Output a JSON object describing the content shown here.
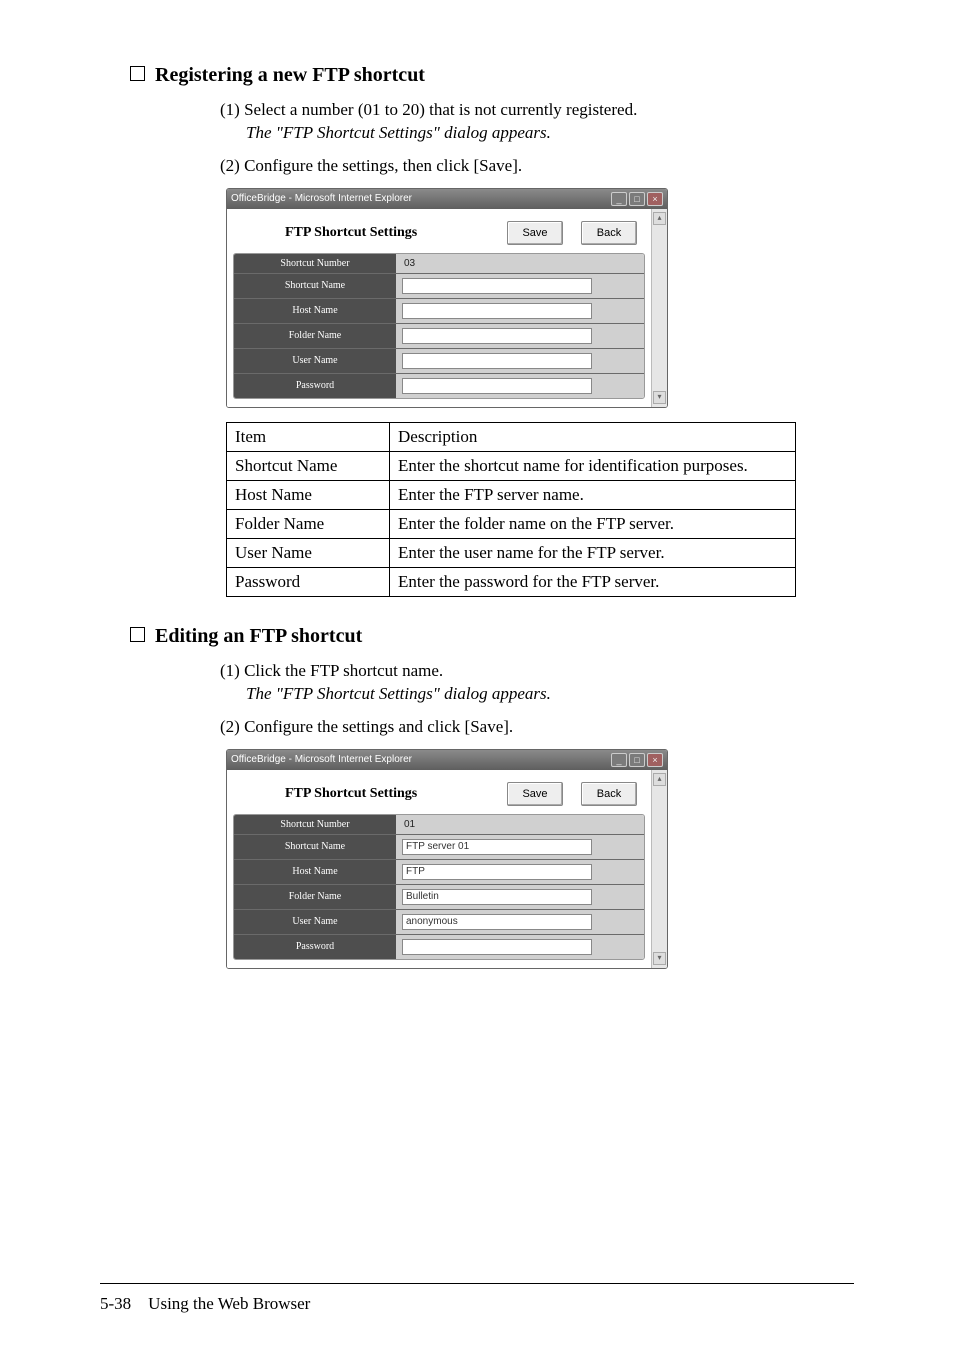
{
  "section1": {
    "title": "Registering a new FTP shortcut",
    "step1": "(1) Select a number (01 to 20) that is not currently registered.",
    "step1_note": "The \"FTP Shortcut Settings\" dialog appears.",
    "step2": "(2) Configure the settings, then click [Save]."
  },
  "section2": {
    "title": "Editing an FTP shortcut",
    "step1": "(1) Click the FTP shortcut name.",
    "step1_note": "The \"FTP Shortcut Settings\" dialog appears.",
    "step2": "(2) Configure the settings and click [Save]."
  },
  "ie_title": "OfficeBridge - Microsoft Internet Explorer",
  "dialog": {
    "title": "FTP Shortcut Settings",
    "save": "Save",
    "back": "Back",
    "labels": {
      "number": "Shortcut Number",
      "name": "Shortcut Name",
      "host": "Host Name",
      "folder": "Folder Name",
      "user": "User Name",
      "pass": "Password"
    }
  },
  "dlg1": {
    "number": "03",
    "name": "",
    "host": "",
    "folder": "",
    "user": "",
    "pass": ""
  },
  "dlg2": {
    "number": "01",
    "name": "FTP server 01",
    "host": "FTP",
    "folder": "Bulletin",
    "user": "anonymous",
    "pass": ""
  },
  "desc": {
    "h1": "Item",
    "h2": "Description",
    "r1a": "Shortcut Name",
    "r1b": "Enter the shortcut name for identification purposes.",
    "r2a": "Host Name",
    "r2b": "Enter the FTP server name.",
    "r3a": "Folder Name",
    "r3b": "Enter the folder name on the FTP server.",
    "r4a": "User Name",
    "r4b": "Enter the user name for the FTP server.",
    "r5a": "Password",
    "r5b": "Enter the password for the FTP server."
  },
  "footer": {
    "page": "5-38",
    "chapter": "Using the Web Browser"
  }
}
